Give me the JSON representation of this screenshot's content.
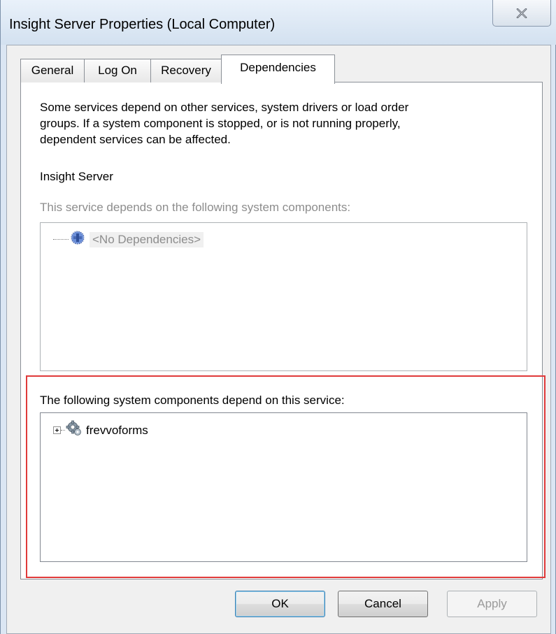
{
  "window": {
    "title": "Insight Server Properties (Local Computer)",
    "close_icon": "close-x-icon"
  },
  "tabs": [
    {
      "label": "General",
      "active": false
    },
    {
      "label": "Log On",
      "active": false
    },
    {
      "label": "Recovery",
      "active": false
    },
    {
      "label": "Dependencies",
      "active": true
    }
  ],
  "dependencies": {
    "description_lines": [
      "Some services depend on other services, system drivers or load order",
      "groups. If a system component is stopped, or is not running properly,",
      "dependent services can be affected."
    ],
    "service_name": "Insight Server",
    "depends_on_label": "This service depends on the following system components:",
    "depends_on_items": [
      {
        "label": "<No Dependencies>",
        "icon": "service-group-icon",
        "disabled": true
      }
    ],
    "dependents_label": "The following system components depend on this service:",
    "dependents_items": [
      {
        "label": "frevvoforms",
        "icon": "gear-service-icon",
        "expandable": true
      }
    ]
  },
  "buttons": {
    "ok": "OK",
    "cancel": "Cancel",
    "apply": "Apply"
  },
  "colors": {
    "highlight_outline": "#e03a3a"
  }
}
